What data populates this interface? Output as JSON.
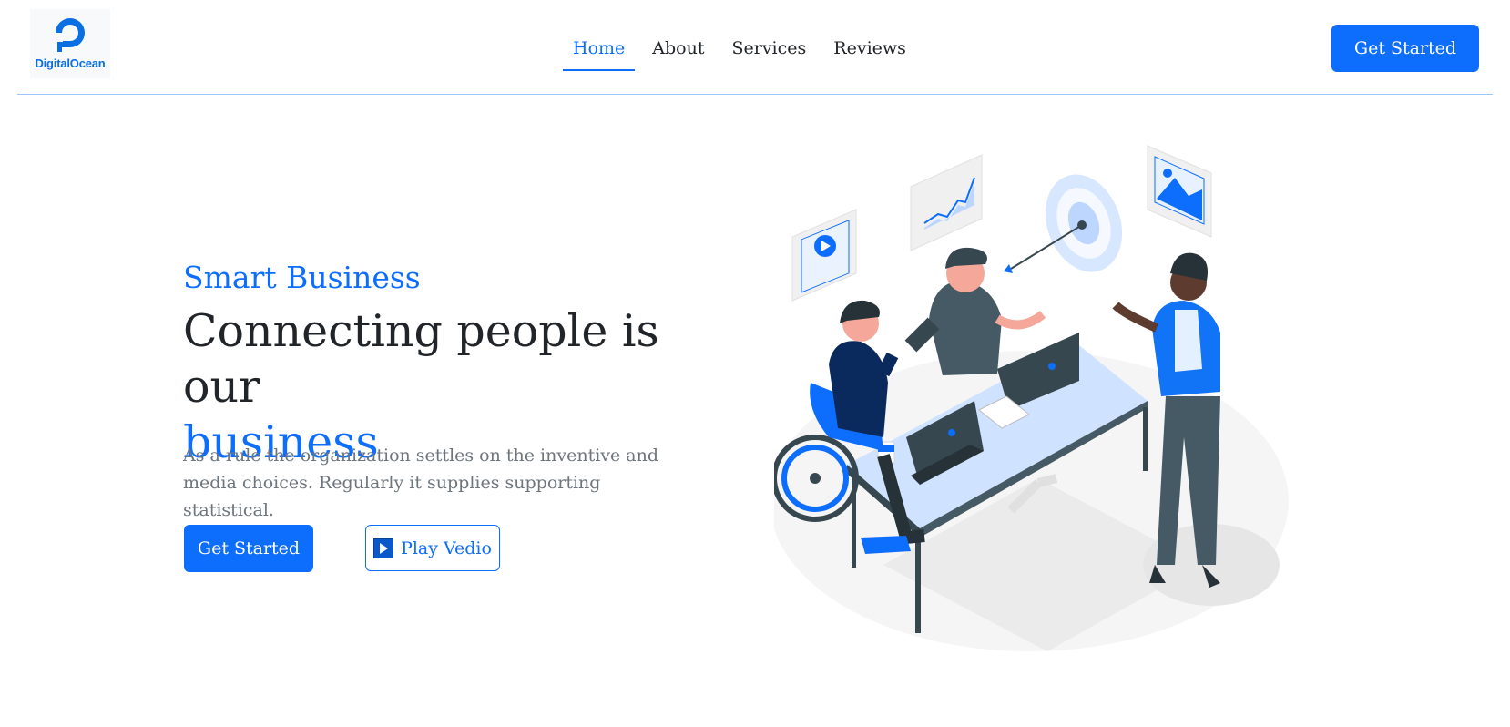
{
  "brand": {
    "name": "DigitalOcean",
    "color": "#0b6ee3"
  },
  "nav": {
    "items": [
      {
        "label": "Home",
        "active": true
      },
      {
        "label": "About",
        "active": false
      },
      {
        "label": "Services",
        "active": false
      },
      {
        "label": "Reviews",
        "active": false
      }
    ],
    "cta_label": "Get Started"
  },
  "hero": {
    "eyebrow": "Smart Business",
    "headline_main": "Connecting people is our",
    "headline_accent": "business",
    "lead": "As a rule the organization settles on the inventive and media choices. Regularly it supplies supporting statistical.",
    "primary_cta": "Get Started",
    "secondary_cta": "Play Vedio",
    "secondary_icon": "play-icon"
  },
  "colors": {
    "accent": "#0d6efd",
    "text": "#212529",
    "muted": "#6c757d"
  }
}
